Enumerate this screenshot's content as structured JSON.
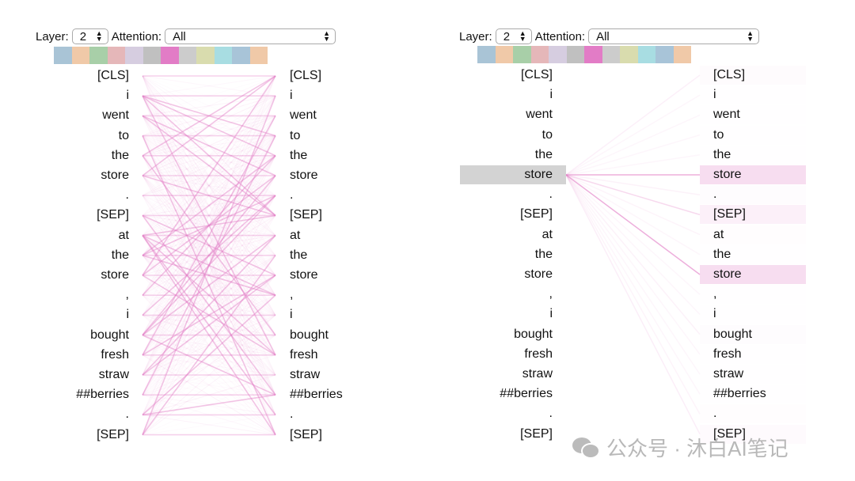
{
  "tokens": [
    "[CLS]",
    "i",
    "went",
    "to",
    "the",
    "store",
    ".",
    "[SEP]",
    "at",
    "the",
    "store",
    ",",
    "i",
    "bought",
    "fresh",
    "straw",
    "##berries",
    ".",
    "[SEP]"
  ],
  "left_panel": {
    "layer_label": "Layer:",
    "layer_value": "2",
    "attention_label": "Attention:",
    "attention_value": "All"
  },
  "right_panel": {
    "layer_label": "Layer:",
    "layer_value": "2",
    "attention_label": "Attention:",
    "attention_value": "All",
    "selected_token_index": 5,
    "attention_from_selected": [
      0.04,
      0.01,
      0.01,
      0.01,
      0.01,
      0.35,
      0.03,
      0.15,
      0.02,
      0.01,
      0.35,
      0.01,
      0.01,
      0.03,
      0.01,
      0.01,
      0.01,
      0.02,
      0.05
    ]
  },
  "head_colors": [
    "#a9c4d6",
    "#f0c9a8",
    "#a8cfa8",
    "#e5b7b9",
    "#d6cde0",
    "#c0c0c0",
    "#e27cc6",
    "#cccccc",
    "#d9dcae",
    "#a8dde2",
    "#a8c4d8",
    "#f0c9a8"
  ],
  "attention_color": "#e27cc6",
  "watermark": "公众号 · 沐白AI笔记"
}
